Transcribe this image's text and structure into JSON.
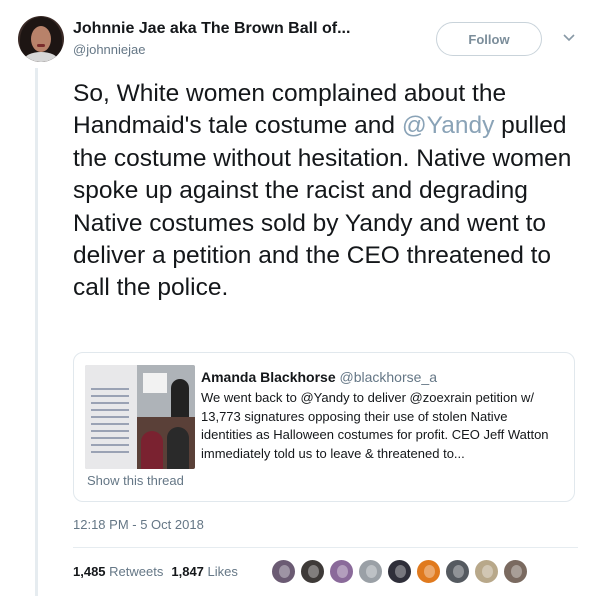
{
  "author": {
    "name": "Johnnie Jae aka The Brown Ball of...",
    "handle": "@johnniejae"
  },
  "follow_label": "Follow",
  "tweet": {
    "text_before": "So, White women complained about the Handmaid's tale costume and ",
    "mention": "@Yandy",
    "text_after": " pulled the costume without hesitation. Native women spoke up against the racist and degrading Native costumes sold by Yandy and went to deliver a petition and the CEO threatened to call the police."
  },
  "quoted": {
    "name": "Amanda Blackhorse",
    "handle": "@blackhorse_a",
    "text": "We went back to @Yandy to deliver @zoexrain petition w/ 13,773 signatures opposing their use of stolen Native identities as Halloween costumes for profit. CEO Jeff Watton immediately told us to leave & threatened to...",
    "show_thread": "Show this thread"
  },
  "timestamp": "12:18 PM - 5 Oct 2018",
  "stats": {
    "retweets_count": "1,485",
    "retweets_label": "Retweets",
    "likes_count": "1,847",
    "likes_label": "Likes"
  },
  "likers": [
    {
      "icon": "liker-avatar-1-icon",
      "color": "#6b5b73"
    },
    {
      "icon": "liker-avatar-2-icon",
      "color": "#3e3a38"
    },
    {
      "icon": "liker-avatar-3-icon",
      "color": "#8a6a9a"
    },
    {
      "icon": "liker-avatar-4-icon",
      "color": "#9aa0a6"
    },
    {
      "icon": "liker-avatar-5-icon",
      "color": "#2f2f3a"
    },
    {
      "icon": "liker-avatar-6-icon",
      "color": "#e07a1e"
    },
    {
      "icon": "liker-avatar-7-icon",
      "color": "#555a60"
    },
    {
      "icon": "liker-avatar-8-icon",
      "color": "#b8a88a"
    },
    {
      "icon": "liker-avatar-9-icon",
      "color": "#7a6a60"
    }
  ],
  "colors": {
    "mention": "#8aa3b7",
    "secondary_text": "#657786",
    "border": "#e1e8ed"
  }
}
